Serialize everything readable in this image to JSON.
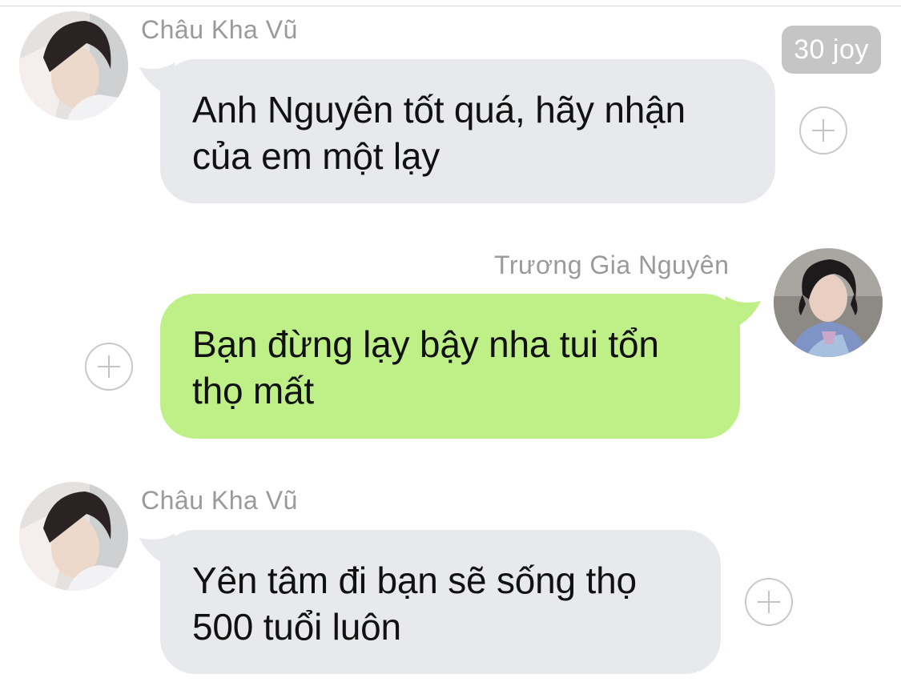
{
  "messages": [
    {
      "sender": "Châu Kha Vũ",
      "direction": "received",
      "lines": [
        "Anh Nguyên tốt quá, hãy nhận",
        "của em một lạy"
      ],
      "badge": "30 joy"
    },
    {
      "sender": "Trương Gia Nguyên",
      "direction": "sent",
      "lines": [
        "Bạn đừng lạy bậy nha tui tổn",
        "thọ mất"
      ]
    },
    {
      "sender": "Châu Kha Vũ",
      "direction": "received",
      "lines": [
        "Yên tâm đi bạn sẽ sống thọ",
        "500 tuổi luôn"
      ]
    }
  ],
  "icons": {
    "reaction": "plus-circle-icon",
    "avatar_received": "avatar-chau-kha-vu",
    "avatar_sent": "avatar-truong-gia-nguyen"
  },
  "colors": {
    "received_bubble": "#e8e9ec",
    "sent_bubble": "#bff088",
    "sender_name": "#9a9a9a",
    "badge_background": "#c5c5c5"
  }
}
